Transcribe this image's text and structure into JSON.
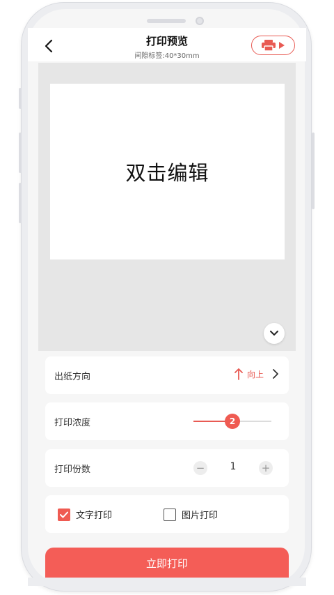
{
  "header": {
    "title": "打印预览",
    "subtitle": "间隙标签:40*30mm"
  },
  "canvas": {
    "label_text": "双击编辑"
  },
  "settings": {
    "direction": {
      "label": "出纸方向",
      "value": "向上"
    },
    "density": {
      "label": "打印浓度",
      "value": "2",
      "level_fraction": 0.5
    },
    "copies": {
      "label": "打印份数",
      "value": "1"
    },
    "print_mode": {
      "text_print": {
        "label": "文字打印",
        "checked": true
      },
      "image_print": {
        "label": "图片打印",
        "checked": false
      }
    }
  },
  "actions": {
    "print_now": "立即打印"
  },
  "colors": {
    "accent": "#ef5b52",
    "canvas_bg": "#e6e6e6"
  },
  "icons": [
    "chevron-left-icon",
    "printer-icon",
    "play-icon",
    "chevron-down-icon",
    "arrow-up-icon",
    "chevron-right-icon",
    "minus-icon",
    "plus-icon",
    "check-icon"
  ]
}
